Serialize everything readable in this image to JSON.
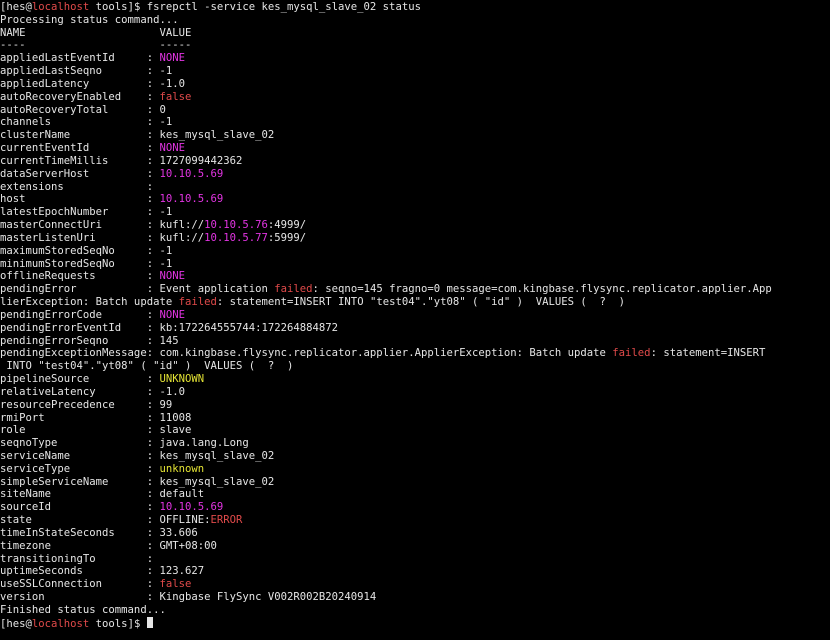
{
  "terminal": {
    "cursor_visible": true,
    "colors": {
      "background": "#000000",
      "text": "#e5e5e5",
      "magenta": "#e234e2",
      "red": "#e04a4a",
      "yellow": "#e2e234"
    },
    "lines": [
      [
        {
          "t": "[hes@"
        },
        {
          "t": "localhost",
          "c": "red"
        },
        {
          "t": " tools]$ fsrepctl -service kes_mysql_slave_02 status"
        }
      ],
      [
        {
          "t": "Processing status command..."
        }
      ],
      [
        {
          "t": "NAME                     VALUE"
        }
      ],
      [
        {
          "t": "----                     -----"
        }
      ],
      [
        {
          "t": "appliedLastEventId     : "
        },
        {
          "t": "NONE",
          "c": "magenta"
        }
      ],
      [
        {
          "t": "appliedLastSeqno       : -1"
        }
      ],
      [
        {
          "t": "appliedLatency         : -1.0"
        }
      ],
      [
        {
          "t": "autoRecoveryEnabled    : "
        },
        {
          "t": "false",
          "c": "red"
        }
      ],
      [
        {
          "t": "autoRecoveryTotal      : 0"
        }
      ],
      [
        {
          "t": "channels               : -1"
        }
      ],
      [
        {
          "t": "clusterName            : kes_mysql_slave_02"
        }
      ],
      [
        {
          "t": "currentEventId         : "
        },
        {
          "t": "NONE",
          "c": "magenta"
        }
      ],
      [
        {
          "t": "currentTimeMillis      : 1727099442362"
        }
      ],
      [
        {
          "t": "dataServerHost         : "
        },
        {
          "t": "10.10.5.69",
          "c": "magenta"
        }
      ],
      [
        {
          "t": "extensions             :"
        }
      ],
      [
        {
          "t": "host                   : "
        },
        {
          "t": "10.10.5.69",
          "c": "magenta"
        }
      ],
      [
        {
          "t": "latestEpochNumber      : -1"
        }
      ],
      [
        {
          "t": "masterConnectUri       : kufl://"
        },
        {
          "t": "10.10.5.76",
          "c": "magenta"
        },
        {
          "t": ":4999/"
        }
      ],
      [
        {
          "t": "masterListenUri        : kufl://"
        },
        {
          "t": "10.10.5.77",
          "c": "magenta"
        },
        {
          "t": ":5999/"
        }
      ],
      [
        {
          "t": "maximumStoredSeqNo     : -1"
        }
      ],
      [
        {
          "t": "minimumStoredSeqNo     : -1"
        }
      ],
      [
        {
          "t": "offlineRequests        : "
        },
        {
          "t": "NONE",
          "c": "magenta"
        }
      ],
      [
        {
          "t": "pendingError           : Event application "
        },
        {
          "t": "failed",
          "c": "red"
        },
        {
          "t": ": seqno=145 fragno=0 message=com.kingbase.flysync.replicator.applier.App"
        }
      ],
      [
        {
          "t": "lierException: Batch update "
        },
        {
          "t": "failed",
          "c": "red"
        },
        {
          "t": ": statement=INSERT INTO \"test04\".\"yt08\" ( \"id\" )  VALUES (  ?  )"
        }
      ],
      [
        {
          "t": "pendingErrorCode       : "
        },
        {
          "t": "NONE",
          "c": "magenta"
        }
      ],
      [
        {
          "t": "pendingErrorEventId    : kb:172264555744:172264884872"
        }
      ],
      [
        {
          "t": "pendingErrorSeqno      : 145"
        }
      ],
      [
        {
          "t": "pendingExceptionMessage: com.kingbase.flysync.replicator.applier.ApplierException: Batch update "
        },
        {
          "t": "failed",
          "c": "red"
        },
        {
          "t": ": statement=INSERT"
        }
      ],
      [
        {
          "t": " INTO \"test04\".\"yt08\" ( \"id\" )  VALUES (  ?  )"
        }
      ],
      [
        {
          "t": "pipelineSource         : "
        },
        {
          "t": "UNKNOWN",
          "c": "yellow"
        }
      ],
      [
        {
          "t": "relativeLatency        : -1.0"
        }
      ],
      [
        {
          "t": "resourcePrecedence     : 99"
        }
      ],
      [
        {
          "t": "rmiPort                : 11008"
        }
      ],
      [
        {
          "t": "role                   : slave"
        }
      ],
      [
        {
          "t": "seqnoType              : java.lang.Long"
        }
      ],
      [
        {
          "t": "serviceName            : kes_mysql_slave_02"
        }
      ],
      [
        {
          "t": "serviceType            : "
        },
        {
          "t": "unknown",
          "c": "yellow"
        }
      ],
      [
        {
          "t": "simpleServiceName      : kes_mysql_slave_02"
        }
      ],
      [
        {
          "t": "siteName               : default"
        }
      ],
      [
        {
          "t": "sourceId               : "
        },
        {
          "t": "10.10.5.69",
          "c": "magenta"
        }
      ],
      [
        {
          "t": "state                  : OFFLINE:"
        },
        {
          "t": "ERROR",
          "c": "red"
        }
      ],
      [
        {
          "t": "timeInStateSeconds     : 33.606"
        }
      ],
      [
        {
          "t": "timezone               : GMT+08:00"
        }
      ],
      [
        {
          "t": "transitioningTo        :"
        }
      ],
      [
        {
          "t": "uptimeSeconds          : 123.627"
        }
      ],
      [
        {
          "t": "useSSLConnection       : "
        },
        {
          "t": "false",
          "c": "red"
        }
      ],
      [
        {
          "t": "version                : Kingbase FlySync V002R002B20240914"
        }
      ],
      [
        {
          "t": "Finished status command..."
        }
      ],
      [
        {
          "t": "[hes@"
        },
        {
          "t": "localhost",
          "c": "red"
        },
        {
          "t": " tools]$ "
        }
      ]
    ]
  }
}
